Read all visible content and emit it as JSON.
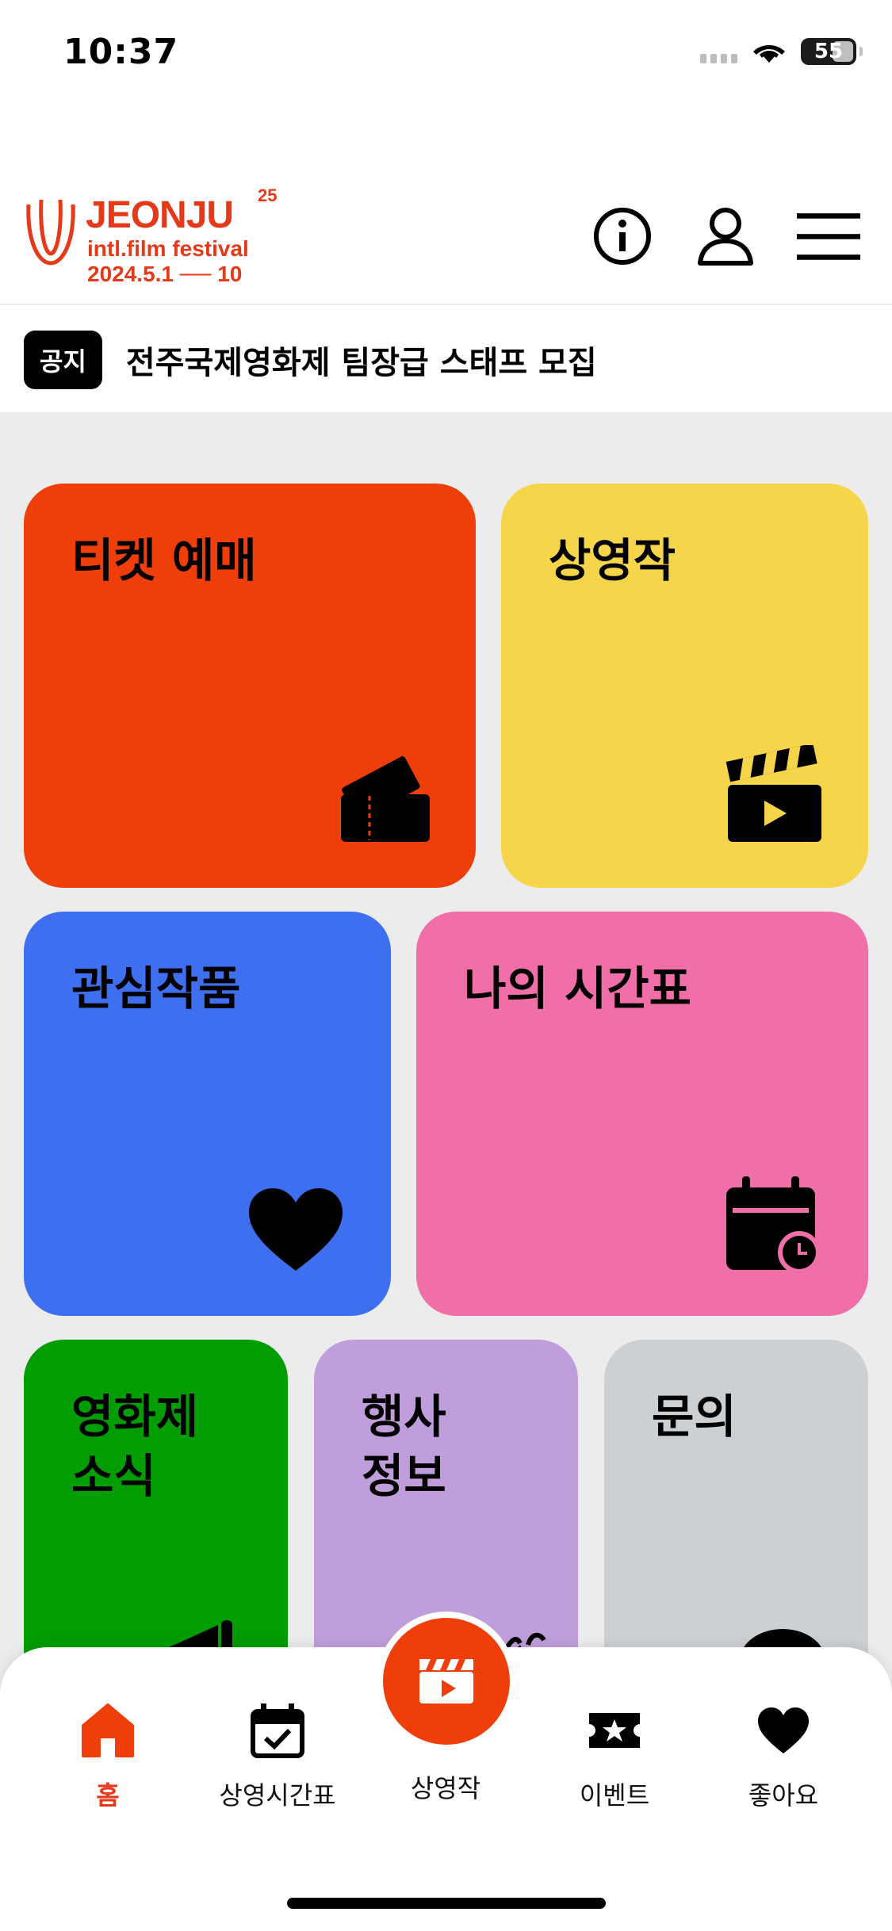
{
  "status_bar": {
    "time": "10:37",
    "battery": "55"
  },
  "header": {
    "logo": {
      "title": "JEONJU",
      "edition": "25",
      "subtitle": "intl.film festival",
      "dates": "2024.5.1 ── 10"
    },
    "actions": [
      "info-icon",
      "user-icon",
      "menu-icon"
    ]
  },
  "notice": {
    "badge": "공지",
    "text": "전주국제영화제 팀장급 스태프 모집"
  },
  "tiles": {
    "ticket": {
      "label": "티켓 예매",
      "color": "#ef3e0a",
      "icon": "ticket-icon"
    },
    "films": {
      "label": "상영작",
      "color": "#f7d54a",
      "icon": "clapperboard-icon"
    },
    "favorites": {
      "label": "관심작품",
      "color": "#3e6ff0",
      "icon": "heart-icon"
    },
    "my_schedule": {
      "label": "나의 시간표",
      "color": "#f06fa8",
      "icon": "calendar-clock-icon"
    },
    "news": {
      "label": "영화제\n소식",
      "color": "#019d03",
      "icon": "megaphone-icon"
    },
    "events": {
      "label": "행사\n정보",
      "color": "#bf9edb",
      "icon": "party-icon"
    },
    "inquiry": {
      "label": "문의",
      "color": "#cdd0d3",
      "icon": "chat-icon"
    }
  },
  "bottom_nav": {
    "items": [
      {
        "label": "홈",
        "icon": "home-icon",
        "active": true
      },
      {
        "label": "상영시간표",
        "icon": "calendar-check-icon",
        "active": false
      },
      {
        "label": "상영작",
        "icon": "clapperboard-icon",
        "active": false
      },
      {
        "label": "이벤트",
        "icon": "star-ticket-icon",
        "active": false
      },
      {
        "label": "좋아요",
        "icon": "heart-icon",
        "active": false
      }
    ]
  },
  "colors": {
    "brand": "#e5391a",
    "accent": "#ef3e0a",
    "grid_bg": "#ececec"
  }
}
